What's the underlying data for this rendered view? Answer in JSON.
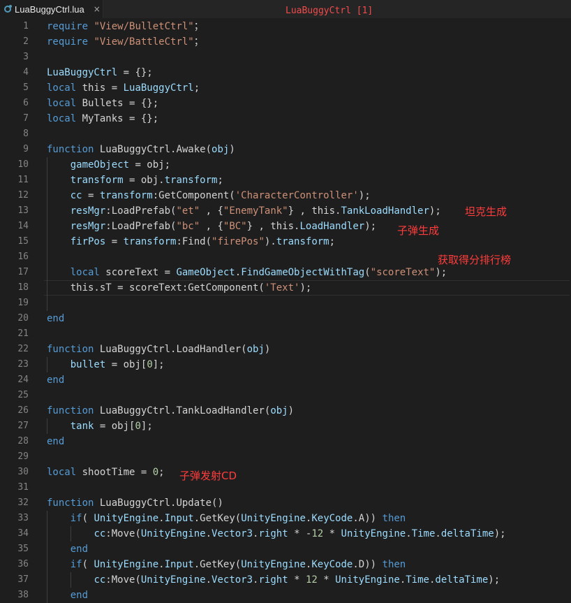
{
  "tab": {
    "label": "LuaBuggyCtrl.lua",
    "close": "×"
  },
  "window_title": "LuaBuggyCtrl [1]",
  "current_line": 18,
  "lines": [
    [
      [
        "kw",
        "require"
      ],
      [
        "str",
        " \"View/BulletCtrl\""
      ],
      [
        "",
        "；"
      ]
    ],
    [
      [
        "kw",
        "require"
      ],
      [
        "str",
        " \"View/BattleCtrl\""
      ],
      [
        "",
        "；"
      ]
    ],
    [],
    [
      [
        "var",
        "LuaBuggyCtrl"
      ],
      [
        "",
        " = {};"
      ]
    ],
    [
      [
        "kw",
        "local"
      ],
      [
        "",
        " this = "
      ],
      [
        "var",
        "LuaBuggyCtrl"
      ],
      [
        "",
        ";"
      ]
    ],
    [
      [
        "kw",
        "local"
      ],
      [
        "",
        " Bullets = {};"
      ]
    ],
    [
      [
        "kw",
        "local"
      ],
      [
        "",
        " MyTanks = {};"
      ]
    ],
    [],
    [
      [
        "kw",
        "function"
      ],
      [
        "",
        " LuaBuggyCtrl.Awake("
      ],
      [
        "var",
        "obj"
      ],
      [
        "",
        ")"
      ]
    ],
    [
      [
        "",
        "    "
      ],
      [
        "var",
        "gameObject"
      ],
      [
        "",
        " = obj;"
      ]
    ],
    [
      [
        "",
        "    "
      ],
      [
        "var",
        "transform"
      ],
      [
        "",
        " = obj."
      ],
      [
        "var",
        "transform"
      ],
      [
        "",
        ";"
      ]
    ],
    [
      [
        "",
        "    "
      ],
      [
        "var",
        "cc"
      ],
      [
        "",
        " = "
      ],
      [
        "var",
        "transform"
      ],
      [
        "",
        ":GetComponent("
      ],
      [
        "str",
        "'CharacterController'"
      ],
      [
        "",
        ");"
      ]
    ],
    [
      [
        "",
        "    "
      ],
      [
        "var",
        "resMgr"
      ],
      [
        "",
        ":LoadPrefab("
      ],
      [
        "str",
        "\"et\""
      ],
      [
        "",
        " , {"
      ],
      [
        "str",
        "\"EnemyTank\""
      ],
      [
        "",
        "} , this."
      ],
      [
        "var",
        "TankLoadHandler"
      ],
      [
        "",
        ");"
      ]
    ],
    [
      [
        "",
        "    "
      ],
      [
        "var",
        "resMgr"
      ],
      [
        "",
        ":LoadPrefab("
      ],
      [
        "str",
        "\"bc\""
      ],
      [
        "",
        " , {"
      ],
      [
        "str",
        "\"BC\""
      ],
      [
        "",
        "} , this."
      ],
      [
        "var",
        "LoadHandler"
      ],
      [
        "",
        ");"
      ]
    ],
    [
      [
        "",
        "    "
      ],
      [
        "var",
        "firPos"
      ],
      [
        "",
        " = "
      ],
      [
        "var",
        "transform"
      ],
      [
        "",
        ":Find("
      ],
      [
        "str",
        "\"firePos\""
      ],
      [
        "",
        ")."
      ],
      [
        "var",
        "transform"
      ],
      [
        "",
        ";"
      ]
    ],
    [],
    [
      [
        "",
        "    "
      ],
      [
        "kw",
        "local"
      ],
      [
        "",
        " scoreText = "
      ],
      [
        "var",
        "GameObject"
      ],
      [
        "",
        "."
      ],
      [
        "var",
        "FindGameObjectWithTag"
      ],
      [
        "",
        "("
      ],
      [
        "str",
        "\"scoreText\""
      ],
      [
        "",
        ");"
      ]
    ],
    [
      [
        "",
        "    this.sT = scoreText:GetComponent("
      ],
      [
        "str",
        "'Text'"
      ],
      [
        "",
        ");"
      ]
    ],
    [],
    [
      [
        "kw",
        "end"
      ]
    ],
    [],
    [
      [
        "kw",
        "function"
      ],
      [
        "",
        " LuaBuggyCtrl.LoadHandler("
      ],
      [
        "var",
        "obj"
      ],
      [
        "",
        ")"
      ]
    ],
    [
      [
        "",
        "    "
      ],
      [
        "var",
        "bullet"
      ],
      [
        "",
        " = obj["
      ],
      [
        "num",
        "0"
      ],
      [
        "",
        "];"
      ]
    ],
    [
      [
        "kw",
        "end"
      ]
    ],
    [],
    [
      [
        "kw",
        "function"
      ],
      [
        "",
        " LuaBuggyCtrl.TankLoadHandler("
      ],
      [
        "var",
        "obj"
      ],
      [
        "",
        ")"
      ]
    ],
    [
      [
        "",
        "    "
      ],
      [
        "var",
        "tank"
      ],
      [
        "",
        " = obj["
      ],
      [
        "num",
        "0"
      ],
      [
        "",
        "];"
      ]
    ],
    [
      [
        "kw",
        "end"
      ]
    ],
    [],
    [
      [
        "kw",
        "local"
      ],
      [
        "",
        " shootTime = "
      ],
      [
        "num",
        "0"
      ],
      [
        "",
        ";"
      ]
    ],
    [],
    [
      [
        "kw",
        "function"
      ],
      [
        "",
        " LuaBuggyCtrl.Update()"
      ]
    ],
    [
      [
        "",
        "    "
      ],
      [
        "kw",
        "if"
      ],
      [
        "",
        "( "
      ],
      [
        "var",
        "UnityEngine"
      ],
      [
        "",
        "."
      ],
      [
        "var",
        "Input"
      ],
      [
        "",
        ".GetKey("
      ],
      [
        "var",
        "UnityEngine"
      ],
      [
        "",
        "."
      ],
      [
        "var",
        "KeyCode"
      ],
      [
        "",
        ".A)) "
      ],
      [
        "kw",
        "then"
      ]
    ],
    [
      [
        "",
        "        "
      ],
      [
        "var",
        "cc"
      ],
      [
        "",
        ":Move("
      ],
      [
        "var",
        "UnityEngine"
      ],
      [
        "",
        "."
      ],
      [
        "var",
        "Vector3"
      ],
      [
        "",
        "."
      ],
      [
        "var",
        "right"
      ],
      [
        "",
        " * -"
      ],
      [
        "num",
        "12"
      ],
      [
        "",
        " * "
      ],
      [
        "var",
        "UnityEngine"
      ],
      [
        "",
        "."
      ],
      [
        "var",
        "Time"
      ],
      [
        "",
        "."
      ],
      [
        "var",
        "deltaTime"
      ],
      [
        "",
        ");"
      ]
    ],
    [
      [
        "",
        "    "
      ],
      [
        "kw",
        "end"
      ]
    ],
    [
      [
        "",
        "    "
      ],
      [
        "kw",
        "if"
      ],
      [
        "",
        "( "
      ],
      [
        "var",
        "UnityEngine"
      ],
      [
        "",
        "."
      ],
      [
        "var",
        "Input"
      ],
      [
        "",
        ".GetKey("
      ],
      [
        "var",
        "UnityEngine"
      ],
      [
        "",
        "."
      ],
      [
        "var",
        "KeyCode"
      ],
      [
        "",
        ".D)) "
      ],
      [
        "kw",
        "then"
      ]
    ],
    [
      [
        "",
        "        "
      ],
      [
        "var",
        "cc"
      ],
      [
        "",
        ":Move("
      ],
      [
        "var",
        "UnityEngine"
      ],
      [
        "",
        "."
      ],
      [
        "var",
        "Vector3"
      ],
      [
        "",
        "."
      ],
      [
        "var",
        "right"
      ],
      [
        "",
        " * "
      ],
      [
        "num",
        "12"
      ],
      [
        "",
        " * "
      ],
      [
        "var",
        "UnityEngine"
      ],
      [
        "",
        "."
      ],
      [
        "var",
        "Time"
      ],
      [
        "",
        "."
      ],
      [
        "var",
        "deltaTime"
      ],
      [
        "",
        ");"
      ]
    ],
    [
      [
        "",
        "    "
      ],
      [
        "kw",
        "end"
      ]
    ]
  ],
  "annotations": {
    "tank_spawn": "坦克生成",
    "bullet_spawn": "子弹生成",
    "leaderboard": "获取得分排行榜",
    "shoot_cd": "子弹发射CD"
  }
}
